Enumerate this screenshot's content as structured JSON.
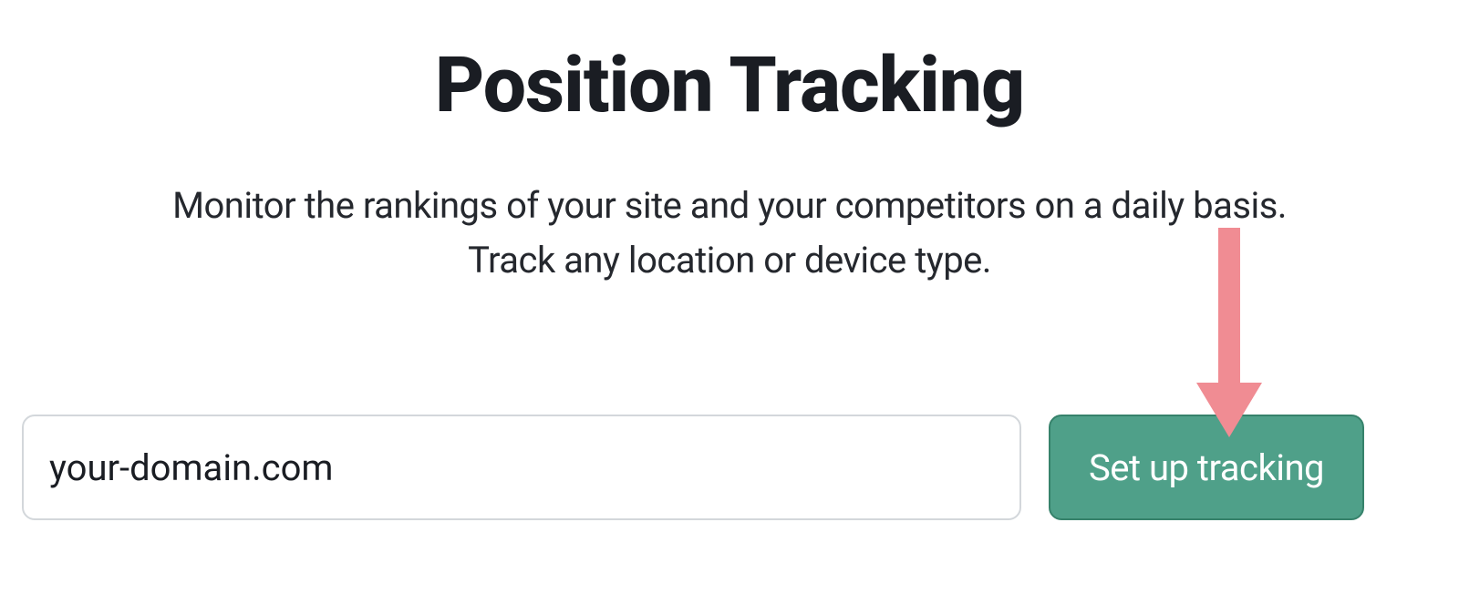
{
  "header": {
    "title": "Position Tracking",
    "subtitle_line1": "Monitor the rankings of your site and your competitors on a daily basis.",
    "subtitle_line2": "Track any location or device type."
  },
  "form": {
    "domain_value": "your-domain.com",
    "button_label": "Set up tracking"
  },
  "annotation": {
    "arrow_color": "#f08c93"
  }
}
